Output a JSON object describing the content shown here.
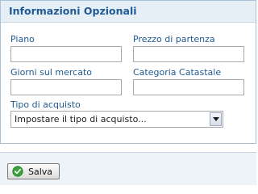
{
  "panel": {
    "title": "Informazioni Opzionali"
  },
  "fields": {
    "piano": {
      "label": "Piano",
      "value": ""
    },
    "prezzo": {
      "label": "Prezzo di partenza",
      "value": ""
    },
    "giorni": {
      "label": "Giorni sul mercato",
      "value": ""
    },
    "categoria": {
      "label": "Categoria Catastale",
      "value": ""
    }
  },
  "tipo": {
    "label": "Tipo di acquisto",
    "selected": "Impostare il tipo di acquisto..."
  },
  "footer": {
    "save_label": "Salva",
    "save_icon": "check-circle-icon"
  },
  "colors": {
    "accent": "#1f5a92",
    "header_bg": "#e6eef6",
    "footer_bg": "#eef3f8",
    "save_icon_green": "#3aa23a"
  }
}
